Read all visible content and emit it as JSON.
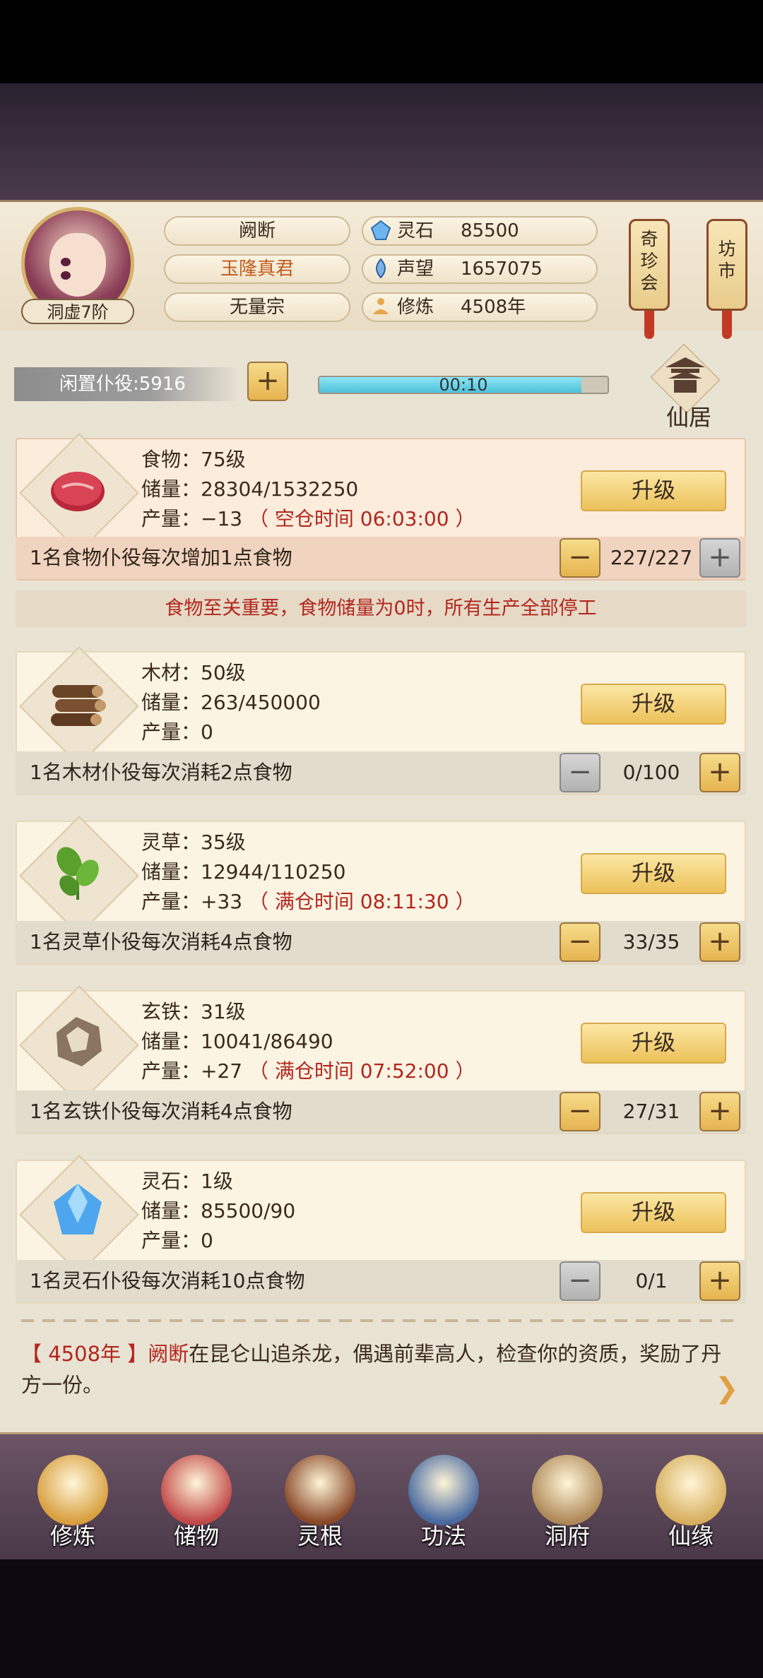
{
  "header": {
    "rank": "洞虚7阶",
    "name": "阙断",
    "title": "玉隆真君",
    "sect": "无量宗",
    "stats": [
      {
        "label": "灵石",
        "value": "85500",
        "icon": "spirit-stone-icon"
      },
      {
        "label": "声望",
        "value": "1657075",
        "icon": "reputation-icon"
      },
      {
        "label": "修炼",
        "value": "4508年",
        "icon": "meditation-icon"
      }
    ],
    "lanterns": [
      {
        "label": "奇珍会",
        "chars": [
          "奇",
          "珍",
          "会"
        ]
      },
      {
        "label": "坊市",
        "chars": [
          "坊",
          "市"
        ]
      }
    ]
  },
  "idle": {
    "label": "闲置仆役:5916",
    "timer": "00:10",
    "progress": 0.91,
    "home_label": "仙居"
  },
  "upgrade_label": "升级",
  "warning": "食物至关重要，食物储量为0时，所有生产全部停工",
  "resources": [
    {
      "name_line": "食物：75级",
      "storage_line": "储量：28304/1532250",
      "output_prefix": "产量：−13",
      "output_note": "（ 空仓时间 06:03:00 ）",
      "desc": "1名食物仆役每次增加1点食物",
      "count": "227/227",
      "minus_enabled": true,
      "plus_enabled": false,
      "icon": "meat-icon"
    },
    {
      "name_line": "木材：50级",
      "storage_line": "储量：263/450000",
      "output_prefix": "产量：0",
      "output_note": "",
      "desc": "1名木材仆役每次消耗2点食物",
      "count": "0/100",
      "minus_enabled": false,
      "plus_enabled": true,
      "icon": "wood-logs-icon"
    },
    {
      "name_line": "灵草：35级",
      "storage_line": "储量：12944/110250",
      "output_prefix": "产量：+33",
      "output_note": "（ 满仓时间 08:11:30 ）",
      "desc": "1名灵草仆役每次消耗4点食物",
      "count": "33/35",
      "minus_enabled": true,
      "plus_enabled": true,
      "icon": "herb-icon"
    },
    {
      "name_line": "玄铁：31级",
      "storage_line": "储量：10041/86490",
      "output_prefix": "产量：+27",
      "output_note": "（ 满仓时间 07:52:00 ）",
      "desc": "1名玄铁仆役每次消耗4点食物",
      "count": "27/31",
      "minus_enabled": true,
      "plus_enabled": true,
      "icon": "iron-ore-icon"
    },
    {
      "name_line": "灵石：1级",
      "storage_line": "储量：85500/90",
      "output_prefix": "产量：0",
      "output_note": "",
      "desc": "1名灵石仆役每次消耗10点食物",
      "count": "0/1",
      "minus_enabled": false,
      "plus_enabled": true,
      "icon": "spirit-crystal-icon"
    }
  ],
  "log": {
    "year": "【 4508年 】",
    "name": "阙断",
    "text": "在昆仑山追杀龙，偶遇前辈高人，检查你的资质，奖励了丹方一份。"
  },
  "nav": [
    {
      "label": "修炼",
      "icon": "cultivate-icon",
      "color": "#d9a040"
    },
    {
      "label": "储物",
      "icon": "storage-bag-icon",
      "color": "#c24a4a"
    },
    {
      "label": "灵根",
      "icon": "spirit-root-icon",
      "color": "#8a4a2a"
    },
    {
      "label": "功法",
      "icon": "scripture-book-icon",
      "color": "#4a6aa0"
    },
    {
      "label": "洞府",
      "icon": "cave-mansion-icon",
      "color": "#b08a5a"
    },
    {
      "label": "仙缘",
      "icon": "fortune-gourd-icon",
      "color": "#d8b060"
    }
  ],
  "colors": {
    "accent_red": "#b3261e",
    "button_gold": "#ecc15a",
    "progress_cyan": "#4ec1db"
  }
}
